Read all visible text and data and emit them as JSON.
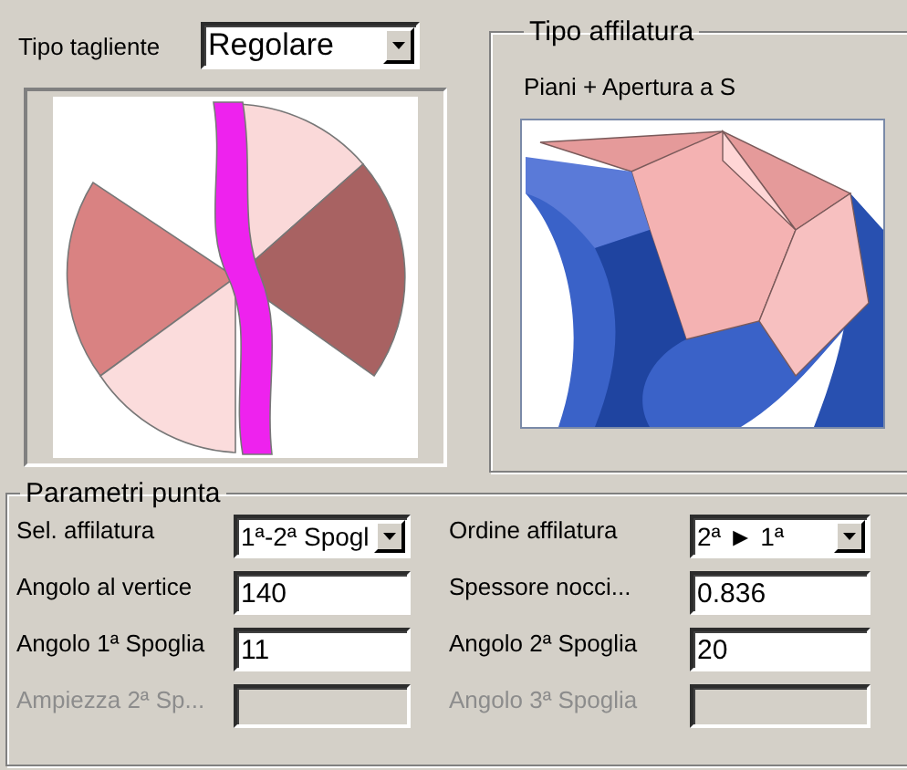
{
  "cutting_type": {
    "label": "Tipo tagliente",
    "value": "Regolare"
  },
  "sharpening_type": {
    "title": "Tipo affilatura",
    "description": "Piani + Apertura a S"
  },
  "tip_parameters": {
    "title": "Parametri punta",
    "fields": [
      {
        "kind": "combo",
        "label": "Sel. affilatura",
        "value": "1ª-2ª Spogl",
        "disabled": false
      },
      {
        "kind": "combo",
        "label": "Ordine affilatura",
        "value": "2ª ► 1ª",
        "disabled": false
      },
      {
        "kind": "text",
        "label": "Angolo al vertice",
        "value": "140",
        "disabled": false
      },
      {
        "kind": "text",
        "label": "Spessore nocci...",
        "value": "0.836",
        "disabled": false
      },
      {
        "kind": "text",
        "label": "Angolo 1ª Spoglia",
        "value": "11",
        "disabled": false
      },
      {
        "kind": "text",
        "label": "Angolo 2ª Spoglia",
        "value": "20",
        "disabled": false
      },
      {
        "kind": "text",
        "label": "Ampiezza 2ª Sp...",
        "disabled": true
      },
      {
        "kind": "text",
        "label": "Angolo 3ª Spoglia",
        "disabled": true
      }
    ]
  }
}
